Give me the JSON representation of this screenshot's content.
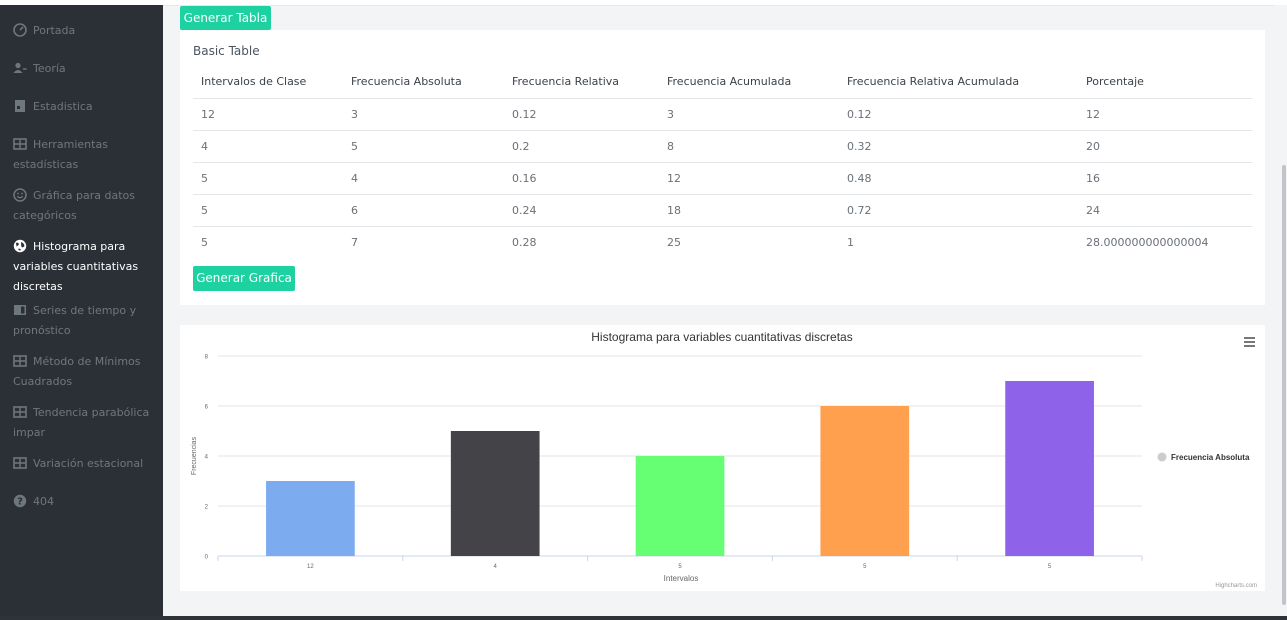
{
  "sidebar": {
    "items": [
      {
        "label": "Portada",
        "icon": "dashboard-icon",
        "active": false
      },
      {
        "label": "Teoría",
        "icon": "users-icon",
        "active": false
      },
      {
        "label": "Estadistica",
        "icon": "book-icon",
        "active": false
      },
      {
        "label": "Herramientas estadísticas",
        "icon": "table-icon",
        "active": false
      },
      {
        "label": "Gráfica para datos categóricos",
        "icon": "smile-icon",
        "active": false
      },
      {
        "label": "Histograma para variables cuantitativas discretas",
        "icon": "globe-icon",
        "active": true
      },
      {
        "label": "Series de tiempo y pronóstico",
        "icon": "columns-icon",
        "active": false
      },
      {
        "label": "Método de Mínimos Cuadrados",
        "icon": "table-icon",
        "active": false
      },
      {
        "label": "Tendencia parabólica impar",
        "icon": "table-icon",
        "active": false
      },
      {
        "label": "Variación estacional",
        "icon": "table-icon",
        "active": false
      },
      {
        "label": "404",
        "icon": "question-icon",
        "active": false
      }
    ]
  },
  "actions": {
    "generate_table_label": "Generar Tabla",
    "generate_chart_label": "Generar Grafica"
  },
  "table_card": {
    "title": "Basic Table",
    "headers": [
      "Intervalos de Clase",
      "Frecuencia Absoluta",
      "Frecuencia Relativa",
      "Frecuencia Acumulada",
      "Frecuencia Relativa Acumulada",
      "Porcentaje"
    ],
    "rows": [
      [
        "12",
        "3",
        "0.12",
        "3",
        "0.12",
        "12"
      ],
      [
        "4",
        "5",
        "0.2",
        "8",
        "0.32",
        "20"
      ],
      [
        "5",
        "4",
        "0.16",
        "12",
        "0.48",
        "16"
      ],
      [
        "5",
        "6",
        "0.24",
        "18",
        "0.72",
        "24"
      ],
      [
        "5",
        "7",
        "0.28",
        "25",
        "1",
        "28.000000000000004"
      ]
    ]
  },
  "chart_data": {
    "type": "bar",
    "title": "Histograma para variables cuantitativas discretas",
    "xlabel": "Intervalos",
    "ylabel": "Frecuencias",
    "categories": [
      "12",
      "4",
      "5",
      "5",
      "5"
    ],
    "series": [
      {
        "name": "Frecuencia Absoluta",
        "values": [
          3,
          5,
          4,
          6,
          7
        ]
      }
    ],
    "bar_colors": [
      "#7cacef",
      "#434348",
      "#66ff74",
      "#ffa04f",
      "#8f63e9"
    ],
    "legend_color": "#cccccc",
    "ylim": [
      0,
      8
    ],
    "yticks": [
      "0",
      "2",
      "4",
      "6",
      "8"
    ],
    "grid": true,
    "legend_position": "right",
    "credits": "Highcharts.com",
    "menu_icon": "hamburger-menu-icon"
  }
}
